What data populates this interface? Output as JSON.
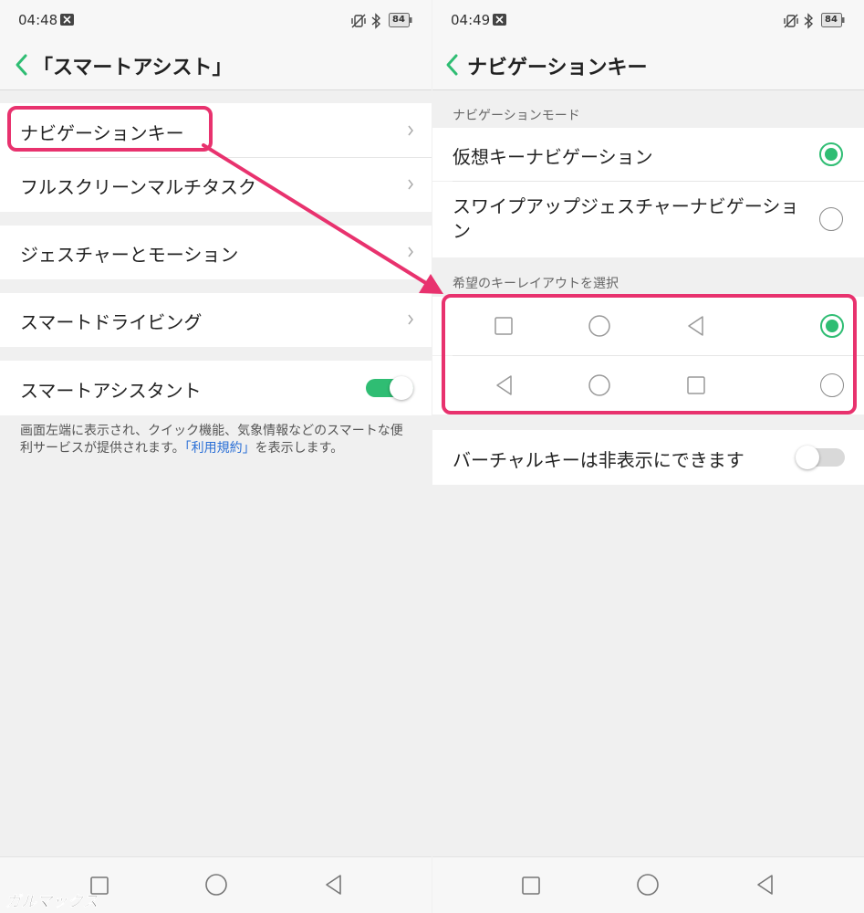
{
  "left": {
    "status": {
      "time": "04:48",
      "battery": "84"
    },
    "header": {
      "title": "「スマートアシスト」"
    },
    "items": [
      {
        "label": "ナビゲーションキー"
      },
      {
        "label": "フルスクリーンマルチタスク"
      },
      {
        "label": "ジェスチャーとモーション"
      },
      {
        "label": "スマートドライビング"
      }
    ],
    "assistant": {
      "label": "スマートアシスタント",
      "toggle_on": true
    },
    "description": {
      "before": "画面左端に表示され、クイック機能、気象情報などのスマートな便利サービスが提供されます。",
      "link": "「利用規約」",
      "after": "を表示します。"
    }
  },
  "right": {
    "status": {
      "time": "04:49",
      "battery": "84"
    },
    "header": {
      "title": "ナビゲーションキー"
    },
    "mode_section": "ナビゲーションモード",
    "modes": [
      {
        "label": "仮想キーナビゲーション",
        "selected": true
      },
      {
        "label": "スワイプアップジェスチャーナビゲーション",
        "selected": false
      }
    ],
    "layout_section": "希望のキーレイアウトを選択",
    "layouts": [
      {
        "keys": [
          "square-icon",
          "circle-icon",
          "triangle-left-icon"
        ],
        "selected": true
      },
      {
        "keys": [
          "triangle-left-icon",
          "circle-icon",
          "square-icon"
        ],
        "selected": false
      }
    ],
    "hide_keys": {
      "label": "バーチャルキーは非表示にできます",
      "toggle_on": false
    }
  },
  "colors": {
    "accent": "#2fbd73",
    "annotation": "#e8326e",
    "link": "#2a6fd6"
  },
  "watermark": "ガルマックス"
}
